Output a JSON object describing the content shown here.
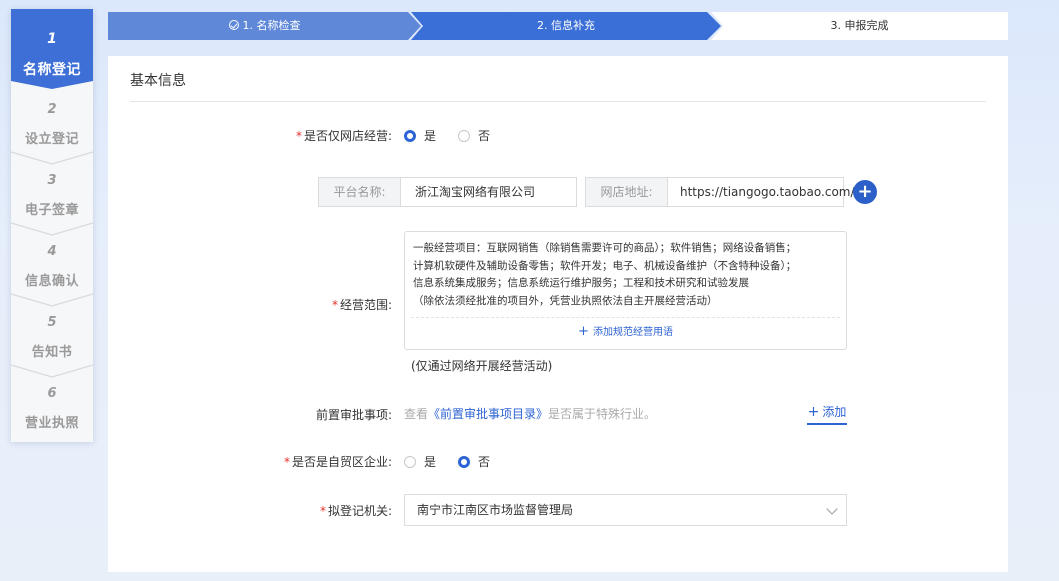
{
  "left_nav": [
    {
      "num": "1",
      "label": "名称登记",
      "active": true
    },
    {
      "num": "2",
      "label": "设立登记",
      "active": false
    },
    {
      "num": "3",
      "label": "电子签章",
      "active": false
    },
    {
      "num": "4",
      "label": "信息确认",
      "active": false
    },
    {
      "num": "5",
      "label": "告知书",
      "active": false
    },
    {
      "num": "6",
      "label": "营业执照",
      "active": false
    }
  ],
  "progress": [
    {
      "label": "1. 名称检查",
      "state": "done"
    },
    {
      "label": "2. 信息补充",
      "state": "current"
    },
    {
      "label": "3. 申报完成",
      "state": "todo"
    }
  ],
  "section": {
    "title": "基本信息"
  },
  "online_only": {
    "required_mark": "*",
    "label": "是否仅网店经营:",
    "options": [
      "是",
      "否"
    ],
    "selected": "是"
  },
  "platform": {
    "label": "平台名称:",
    "value": "浙江淘宝网络有限公司"
  },
  "shop_url": {
    "label": "网店地址:",
    "value": "https://tiangogo.taobao.com/"
  },
  "add_shop_icon": "plus-icon",
  "business_scope": {
    "required_mark": "*",
    "label": "经营范围:",
    "lines": [
      "一般经营项目：互联网销售（除销售需要许可的商品）；软件销售；网络设备销售；",
      "计算机软硬件及辅助设备零售；软件开发；电子、机械设备维护（不含特种设备）；",
      "信息系统集成服务；信息系统运行维护服务；工程和技术研究和试验发展",
      "（除依法须经批准的项目外，凭营业执照依法自主开展经营活动）"
    ],
    "add_text": "添加规范经营用语",
    "note": "(仅通过网络开展经营活动)"
  },
  "pre_approval": {
    "label": "前置审批事项:",
    "hint_prefix": "查看",
    "hint_link": "《前置审批事项目录》",
    "hint_suffix": "是否属于特殊行业。",
    "add_label": "添加"
  },
  "free_trade": {
    "required_mark": "*",
    "label": "是否是自贸区企业:",
    "options": [
      "是",
      "否"
    ],
    "selected": "否"
  },
  "authority": {
    "required_mark": "*",
    "label": "拟登记机关:",
    "value": "南宁市江南区市场监督管理局"
  },
  "colors": {
    "primary": "#3d6fd6",
    "required": "#e0322c",
    "link": "#2d63d4"
  }
}
